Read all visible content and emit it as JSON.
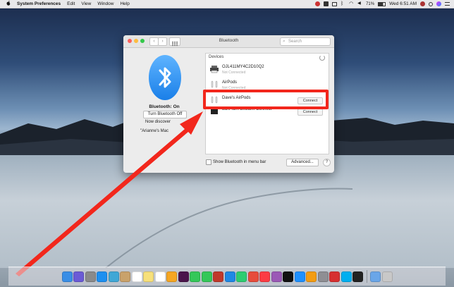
{
  "menubar": {
    "apple_icon": "apple-logo-icon",
    "app_name": "System Preferences",
    "menus": [
      "Edit",
      "View",
      "Window",
      "Help"
    ],
    "status": {
      "battery": "71%",
      "time": "Wed 6:51 AM"
    }
  },
  "window": {
    "title": "Bluetooth",
    "search_placeholder": "Search",
    "bluetooth_status": "Bluetooth: On",
    "turn_off_label": "Turn Bluetooth Off",
    "discoverable_text": "Now discover",
    "computer_name": "\"Arianne's Mac",
    "devices_header": "Devices",
    "devices": [
      {
        "name": "OJL411MY4C2D10Q2",
        "sub": "Not Connected",
        "action": ""
      },
      {
        "name": "AirPods",
        "sub": "Not Connected",
        "action": ""
      },
      {
        "name": "Dave's AirPods",
        "sub": "",
        "action": "Connect"
      },
      {
        "name": "EDIFIER Exclaim Connect",
        "sub": "",
        "action": "Connect"
      }
    ],
    "show_in_menubar_label": "Show Bluetooth in menu bar",
    "advanced_label": "Advanced...",
    "help_label": "?"
  },
  "annotation": {
    "highlight_color": "#f2271c"
  },
  "dock": {
    "icons": [
      "finder-icon",
      "siri-icon",
      "launchpad-icon",
      "safari-icon",
      "preview-icon",
      "contacts-icon",
      "calendar-icon",
      "notes-icon",
      "reminders-icon",
      "photos-icon",
      "slack-icon",
      "messages-icon",
      "facetime-icon",
      "photo-booth-icon",
      "keynote-icon",
      "numbers-icon",
      "news-icon",
      "music-icon",
      "podcasts-icon",
      "tv-icon",
      "app-store-icon",
      "books-icon",
      "system-preferences-icon",
      "acrobat-icon",
      "skype-icon",
      "terminal-icon",
      "folder-icon",
      "trash-icon"
    ]
  }
}
